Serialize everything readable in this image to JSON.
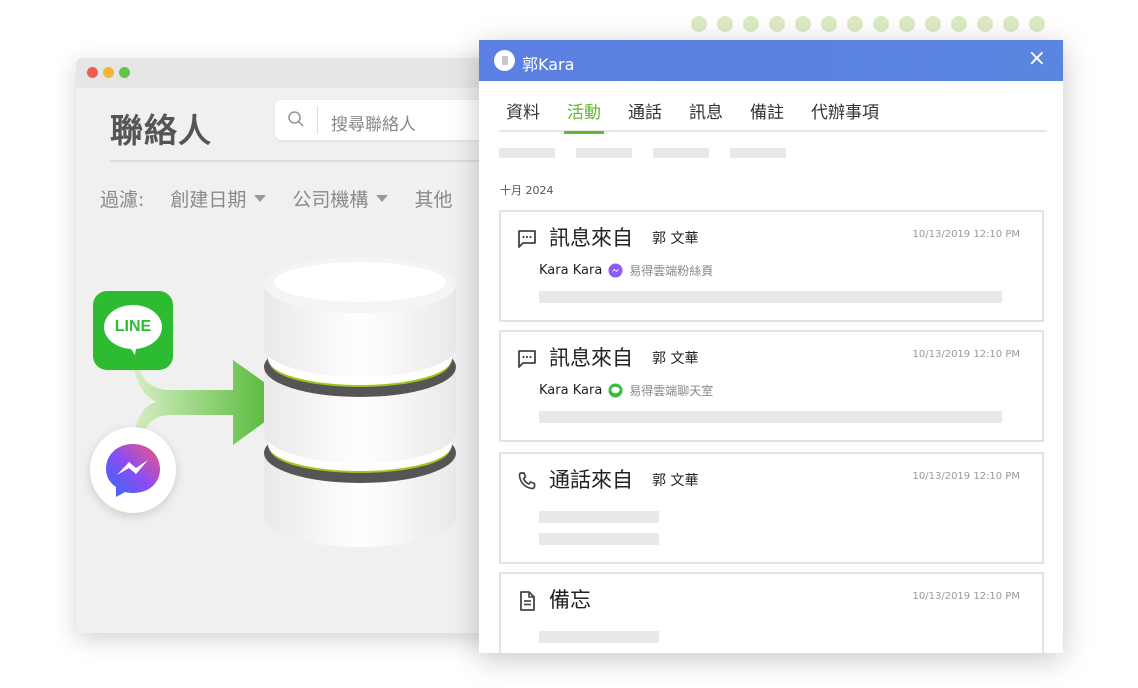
{
  "background_window": {
    "heading": "聯絡人",
    "search_placeholder": "搜尋聯絡人",
    "filter_label": "過濾:",
    "filters": [
      "創建日期",
      "公司機構",
      "其他"
    ]
  },
  "logos": {
    "line_text": "LINE"
  },
  "panel": {
    "title": "郭Kara",
    "close_label": "×",
    "tabs": [
      {
        "label": "資料",
        "active": false
      },
      {
        "label": "活動",
        "active": true
      },
      {
        "label": "通話",
        "active": false
      },
      {
        "label": "訊息",
        "active": false
      },
      {
        "label": "備註",
        "active": false
      },
      {
        "label": "代辦事項",
        "active": false
      }
    ],
    "month_label": "十月 2024",
    "cards": [
      {
        "icon": "message-icon",
        "title": "訊息來自",
        "contact": "郭 文華",
        "timestamp": "10/13/2019 12:10 PM",
        "sender": "Kara Kara",
        "channel_icon": "messenger-icon",
        "channel": "易得雲端粉絲頁"
      },
      {
        "icon": "message-icon",
        "title": "訊息來自",
        "contact": "郭 文華",
        "timestamp": "10/13/2019 12:10 PM",
        "sender": "Kara Kara",
        "channel_icon": "line-icon",
        "channel": "易得雲端聊天室"
      },
      {
        "icon": "phone-icon",
        "title": "通話來自",
        "contact": "郭 文華",
        "timestamp": "10/13/2019 12:10 PM"
      },
      {
        "icon": "note-icon",
        "title": "備忘",
        "timestamp": "10/13/2019 12:10 PM"
      }
    ]
  },
  "colors": {
    "accent_green": "#5fb82f",
    "header_blue": "#5b7fe2",
    "line_green": "#2dbb32"
  }
}
